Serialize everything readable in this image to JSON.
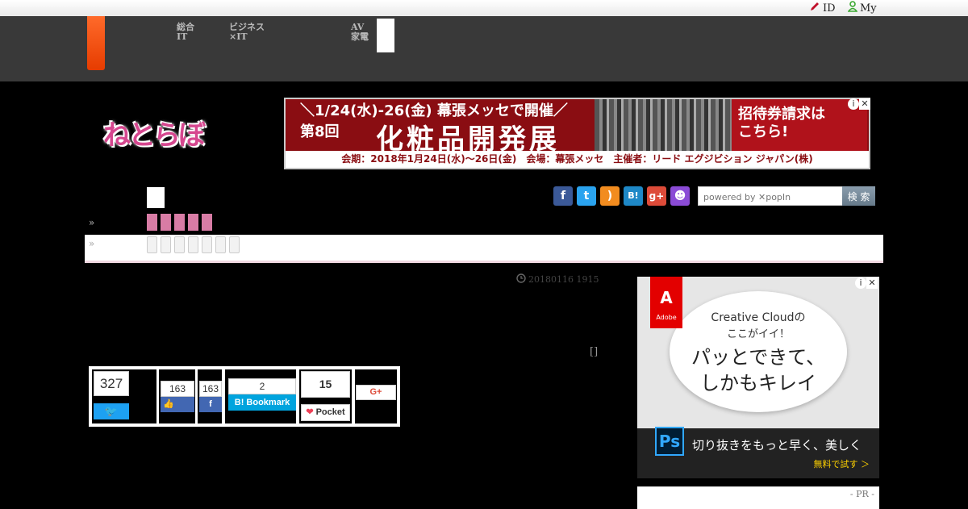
{
  "topbar": {
    "id_label": "ID",
    "my_label": "My"
  },
  "nav": {
    "items": [
      "総合\nIT",
      "ビジネス\n×IT",
      "AV\n家電"
    ]
  },
  "banner": {
    "line1": "＼1/24(水)-26(金) 幕張メッセで開催／",
    "number": "第8回",
    "title": "化粧品開発展",
    "cta": "招待券請求は\nこちら!",
    "footer": "会期：2018年1月24日(水)〜26日(金)　会場：幕張メッセ　主催者：リード エグジビション ジャパン(株)"
  },
  "logo_text": "ねとらぼ",
  "search": {
    "placeholder": "powered by ✕popIn",
    "button": "検 索"
  },
  "breadcrumb": {
    "chev1": "»",
    "chev2": "»"
  },
  "article": {
    "timestamp": "20180116 1915",
    "bracket": "[]"
  },
  "share": {
    "twitter_count": "327",
    "facebook_like_count": "163",
    "facebook_share_count": "163",
    "hatena_count": "2",
    "hatena_label": "B! Bookmark",
    "pocket_count": "15",
    "pocket_label": "Pocket",
    "gplus_label": "G+"
  },
  "side_ad": {
    "brand": "Adobe",
    "line1": "Creative Cloudの",
    "line2": "ここがイイ！",
    "headline1": "パッとできて、",
    "headline2": "しかもキレイ",
    "ps_label": "Ps",
    "tagline": "切り抜きをもっと早く、美しく",
    "cta": "無料で試す ＞"
  },
  "pr_label": "- PR -"
}
